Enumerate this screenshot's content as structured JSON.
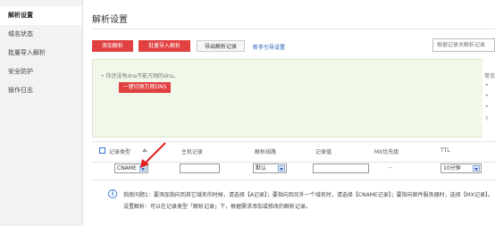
{
  "sidebar": {
    "items": [
      {
        "label": "解析设置",
        "active": true
      },
      {
        "label": "域名状态"
      },
      {
        "label": "批量导入解析"
      },
      {
        "label": "安全防护"
      },
      {
        "label": "操作日志"
      }
    ]
  },
  "main": {
    "title": "解析设置",
    "toolbar": {
      "add_label": "添加解析",
      "batch_label": "批量导入解析",
      "export_label": "导出解析记录",
      "new_guide_label": "新手引导设置"
    },
    "search": {
      "placeholder": "根据记录关解析记录"
    },
    "notice": {
      "text": "• 你还没有dns不能万网的dns。",
      "button_label": "一键切换万网DNS",
      "right_title": "常见",
      "right_items": [
        "•",
        "•",
        "•",
        "?"
      ]
    },
    "table": {
      "headers": [
        "记录类型",
        "主机记录",
        "解析线路",
        "记录值",
        "MX优先级",
        "TTL"
      ],
      "row": {
        "type": "CNAME",
        "line": "默认",
        "mx_placeholder": "--",
        "ttl": "10分钟"
      }
    },
    "info": {
      "line1": "指南问题1：要添加指向到其它域名的时候，请选择【A记录】；要指向到另外一个域名时，请选择【CNAME记录】；要指向邮件服务器时，选择【MX记录】。",
      "line2": "设置解析：可以在记录类型「解析记录」下，根据需求添加或修改的解析记录。"
    }
  }
}
